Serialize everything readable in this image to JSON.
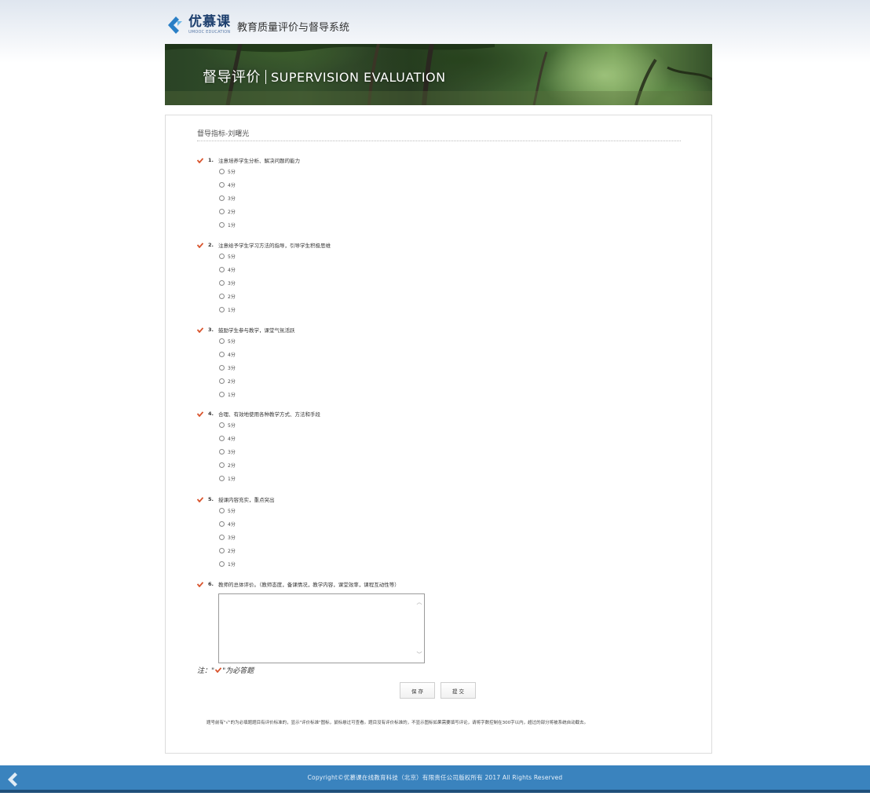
{
  "header": {
    "logo_cn": "优慕课",
    "logo_en": "UMOOC EDUCATION",
    "system_title": "教育质量评价与督导系统"
  },
  "banner": {
    "title_cn": "督导评价",
    "title_en": "SUPERVISION EVALUATION"
  },
  "form": {
    "heading": "督导指标-刘曙光",
    "questions": [
      {
        "number": "1.",
        "text": "注意培养学生分析、解决问题的能力",
        "options": [
          "5分",
          "4分",
          "3分",
          "2分",
          "1分"
        ]
      },
      {
        "number": "2.",
        "text": "注意给予学生学习方法的指导，引导学生积极思维",
        "options": [
          "5分",
          "4分",
          "3分",
          "2分",
          "1分"
        ]
      },
      {
        "number": "3.",
        "text": "鼓励学生参与教学，课堂气氛活跃",
        "options": [
          "5分",
          "4分",
          "3分",
          "2分",
          "1分"
        ]
      },
      {
        "number": "4.",
        "text": "合理、有效地使用各种教学方式、方法和手段",
        "options": [
          "5分",
          "4分",
          "3分",
          "2分",
          "1分"
        ]
      },
      {
        "number": "5.",
        "text": "授课内容充实，重点突出",
        "options": [
          "5分",
          "4分",
          "3分",
          "2分",
          "1分"
        ]
      },
      {
        "number": "6.",
        "text": "教师的总体评价。（教师态度，备课情况，教学内容，课堂效率，课程互动性等）"
      }
    ],
    "comment_value": "",
    "note_prefix": "注：\"",
    "note_suffix": "\"为必答题",
    "save_label": "保 存",
    "submit_label": "提 交",
    "instructions": "题号前有\"√\"的为必填题题目有评价标准的，显示\"评价标准\"图标，鼠标悬过可查看。题目没有评价标准的，不显示图标如果需要填写评论，请将字数控制在300字以内，超过的部分将被系统自动截去。"
  },
  "footer": {
    "copyright": "Copyright©优慕课在线教育科技（北京）有限责任公司版权所有 2017 All Rights Reserved"
  },
  "colors": {
    "accent_check": "#d9532c",
    "footer_bg": "#3a83be",
    "logo_blue": "#1d3f6e"
  }
}
